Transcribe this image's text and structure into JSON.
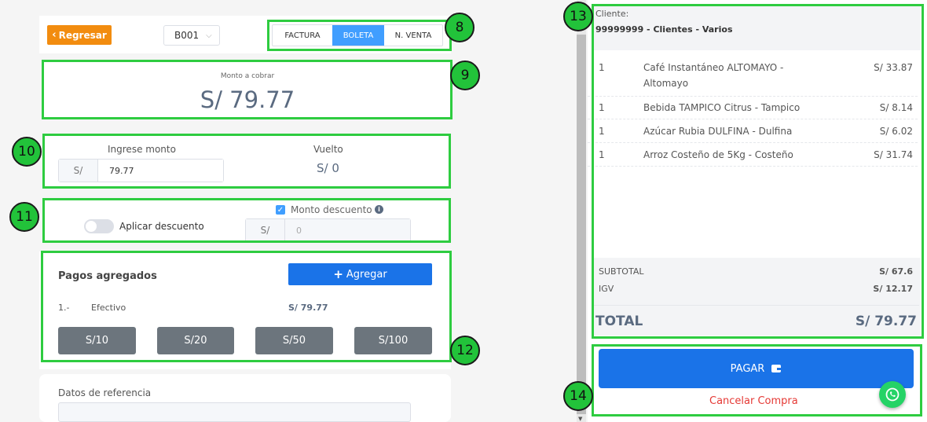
{
  "header": {
    "back_label": "Regresar",
    "series": "B001",
    "doc_types": [
      "FACTURA",
      "BOLETA",
      "N. VENTA"
    ],
    "active_doc_type": "BOLETA"
  },
  "badges": [
    "8",
    "9",
    "10",
    "11",
    "12",
    "13",
    "14"
  ],
  "amount": {
    "label": "Monto a cobrar",
    "value": "S/ 79.77"
  },
  "payment_input": {
    "label": "Ingrese monto",
    "prefix": "S/",
    "value": "79.77",
    "change_label": "Vuelto",
    "change_value": "S/ 0"
  },
  "discount": {
    "toggle_label": "Aplicar descuento",
    "toggle_on": false,
    "checkbox_label": "Monto descuento",
    "checkbox_checked": true,
    "prefix": "S/",
    "value": "0"
  },
  "payments": {
    "title": "Pagos agregados",
    "add_label": "Agregar",
    "items": [
      {
        "index": "1.-",
        "method": "Efectivo",
        "amount": "S/ 79.77"
      }
    ],
    "quick_amounts": [
      "S/10",
      "S/20",
      "S/50",
      "S/100"
    ]
  },
  "reference": {
    "label": "Datos de referencia"
  },
  "receipt": {
    "client_label": "Cliente:",
    "client_value": "99999999 - Clientes - Varios",
    "lines": [
      {
        "qty": "1",
        "desc1": "Café Instantáneo ALTOMAYO -",
        "desc2": "Altomayo",
        "price": "S/ 33.87"
      },
      {
        "qty": "1",
        "desc1": "Bebida TAMPICO Citrus - Tampico",
        "desc2": "",
        "price": "S/ 8.14"
      },
      {
        "qty": "1",
        "desc1": "Azúcar Rubia DULFINA - Dulfina",
        "desc2": "",
        "price": "S/ 6.02"
      },
      {
        "qty": "1",
        "desc1": "Arroz Costeño de 5Kg - Costeño",
        "desc2": "",
        "price": "S/ 31.74"
      }
    ],
    "subtotal_label": "SUBTOTAL",
    "subtotal_value": "S/ 67.6",
    "igv_label": "IGV",
    "igv_value": "S/ 12.17",
    "total_label": "TOTAL",
    "total_value": "S/ 79.77"
  },
  "actions": {
    "pay_label": "PAGAR",
    "cancel_label": "Cancelar Compra"
  },
  "colors": {
    "accent": "#409eff",
    "pay": "#1a73e8",
    "back": "#f28c0f",
    "annotation": "#22c33a",
    "cancel": "#e53935",
    "whatsapp": "#25d366"
  }
}
